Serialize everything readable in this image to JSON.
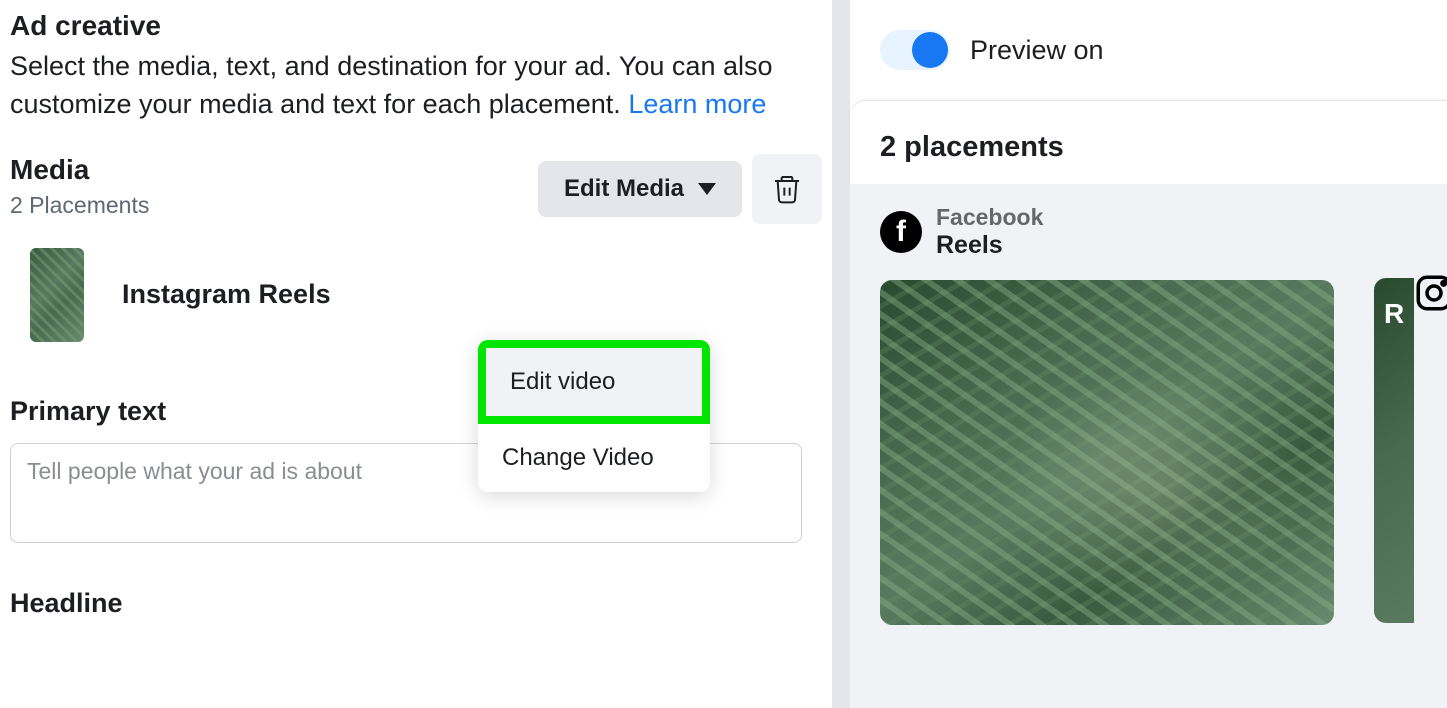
{
  "adCreative": {
    "title": "Ad creative",
    "description": "Select the media, text, and destination for your ad. You can also customize your media and text for each placement.",
    "learnMore": "Learn more"
  },
  "media": {
    "title": "Media",
    "subtitle": "2 Placements",
    "editButton": "Edit Media",
    "dropdown": {
      "editVideo": "Edit video",
      "changeVideo": "Change Video"
    },
    "item": {
      "label": "Instagram Reels"
    }
  },
  "primaryText": {
    "label": "Primary text",
    "placeholder": "Tell people what your ad is about"
  },
  "headline": {
    "label": "Headline"
  },
  "preview": {
    "toggleLabel": "Preview on",
    "placementsTitle": "2 placements",
    "placements": [
      {
        "network": "Facebook",
        "type": "Reels"
      }
    ],
    "secondLetter": "R"
  }
}
